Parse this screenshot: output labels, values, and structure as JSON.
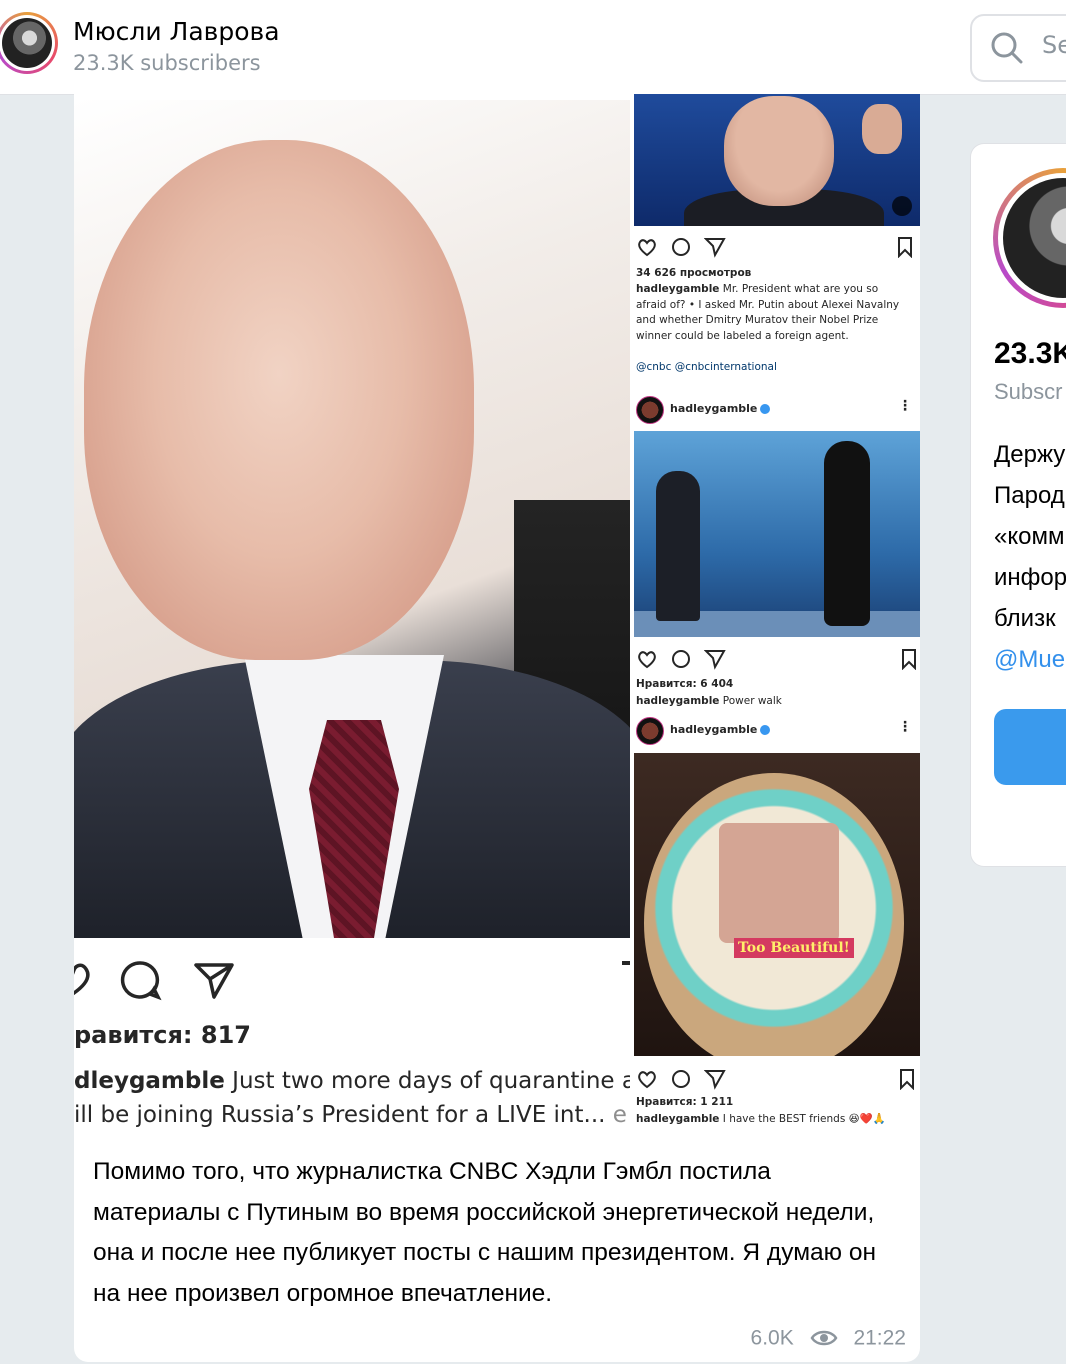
{
  "header": {
    "channel_name": "Мюсли Лаврова",
    "subscribers": "23.3K subscribers",
    "search_placeholder": "Se"
  },
  "post": {
    "big_post": {
      "likes": "равится: 817",
      "caption_user": "dleygamble",
      "caption_line1": " Just two more days of quarantine ar",
      "caption_line2": "ill be joining Russia’s President for a LIVE int...",
      "caption_more": " e"
    },
    "insta1": {
      "views": "34 626 просмотров",
      "user": "hadleygamble",
      "caption": " Mr. President what are you so afraid of? • I asked Mr. Putin about Alexei Navalny and whether Dmitry Muratov their Nobel Prize winner could be labeled a foreign agent.",
      "mentions": "@cnbc @cnbcinternational"
    },
    "insta2": {
      "username": "hadleygamble",
      "likes": "Нравится: 6 404",
      "caption_user": "hadleygamble",
      "caption": " Power walk"
    },
    "insta3": {
      "username": "hadleygamble",
      "cake_label": "Too Beautiful!",
      "likes": "Нравится: 1 211",
      "caption_user": "hadleygamble",
      "caption": " I have the BEST friends 😆❤️🙏"
    },
    "text": "Помимо того, что журналистка CNBC Хэдли Гэмбл постила материалы с Путиным во время российской энергетической недели, она и после нее публикует посты с нашим президентом. Я думаю он на нее произвел огромное впечатление.",
    "views": "6.0K",
    "time": "21:22"
  },
  "side_card": {
    "count": "23.3K",
    "sub_label": "Subscr",
    "desc_lines": [
      "Держу",
      "Пароди",
      "«комм",
      "инфор",
      "близк"
    ],
    "link": "@Mue"
  },
  "colors": {
    "accent": "#3390ec",
    "background": "#e6ebee",
    "meta": "#8c959d"
  }
}
